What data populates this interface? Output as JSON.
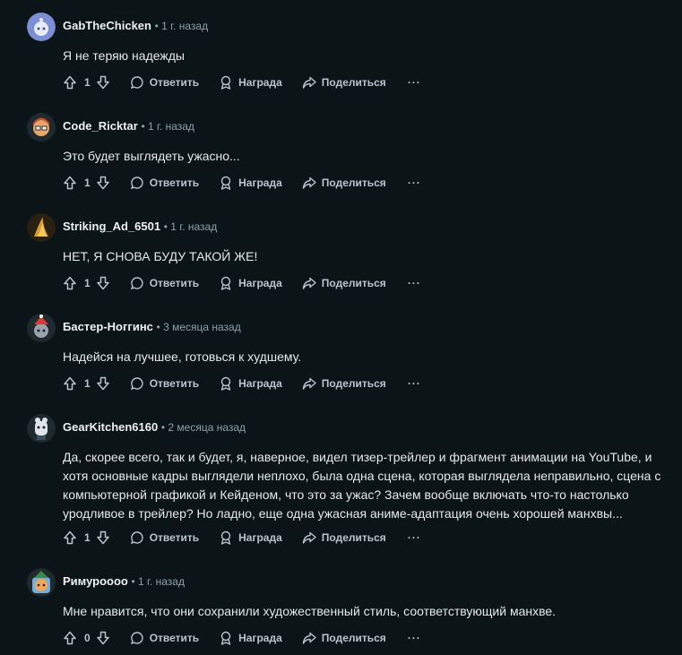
{
  "labels": {
    "reply": "Ответить",
    "award": "Награда",
    "share": "Поделиться",
    "more": "···"
  },
  "comments": [
    {
      "user": "GabTheChicken",
      "time": "1 г. назад",
      "text": "Я не теряю надежды",
      "votes": "1",
      "avatar_color": "#7c8fd6"
    },
    {
      "user": "Code_Ricktar",
      "time": "1 г. назад",
      "text": "Это будет выглядеть ужасно...",
      "votes": "1",
      "avatar_color": "#c94b2a"
    },
    {
      "user": "Striking_Ad_6501",
      "time": "1 г. назад",
      "text": "НЕТ, Я СНОВА БУДУ ТАКОЙ ЖЕ!",
      "votes": "1",
      "avatar_color": "#8a6a2a"
    },
    {
      "user": "Бастер-Ноггинс",
      "time": "3 месяца назад",
      "text": "Надейся на лучшее, готовься к худшему.",
      "votes": "1",
      "avatar_color": "#9aa3ad"
    },
    {
      "user": "GearKitchen6160",
      "time": "2 месяца назад",
      "text": "Да, скорее всего, так и будет, я, наверное, видел тизер-трейлер и фрагмент анимации на YouTube, и хотя основные кадры выглядели неплохо, была одна сцена, которая выглядела неправильно, сцена с компьютерной графикой и Кейденом, что это за ужас? Зачем вообще включать что-то настолько уродливое в трейлер? Но ладно, еще одна ужасная аниме-адаптация очень хорошей манхвы...",
      "votes": "1",
      "avatar_color": "#dfe5ea"
    },
    {
      "user": "Римурoooo",
      "time": "1 г. назад",
      "text": "Мне нравится, что они сохранили художественный стиль, соответствующий манхве.",
      "votes": "0",
      "avatar_color": "#6fb0e0"
    }
  ]
}
